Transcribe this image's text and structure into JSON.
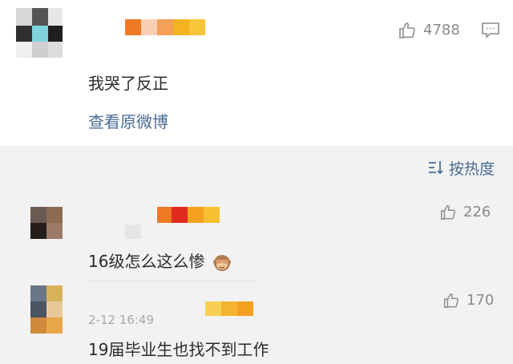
{
  "post": {
    "like_count": "4788",
    "comment": "我哭了反正",
    "view_original": "查看原微博"
  },
  "sort": {
    "label": "按热度"
  },
  "replies": [
    {
      "likes": "226",
      "text": "16级怎么这么惨",
      "emoji": "see-no-evil-monkey-icon"
    },
    {
      "likes": "170",
      "timestamp": "2-12 16:49",
      "text": "19届毕业生也找不到工作"
    }
  ],
  "colors": {
    "link": "#4a6c94",
    "muted": "#8a8a8a",
    "card_bg": "#ffffff",
    "page_bg": "#f2f2f2"
  }
}
